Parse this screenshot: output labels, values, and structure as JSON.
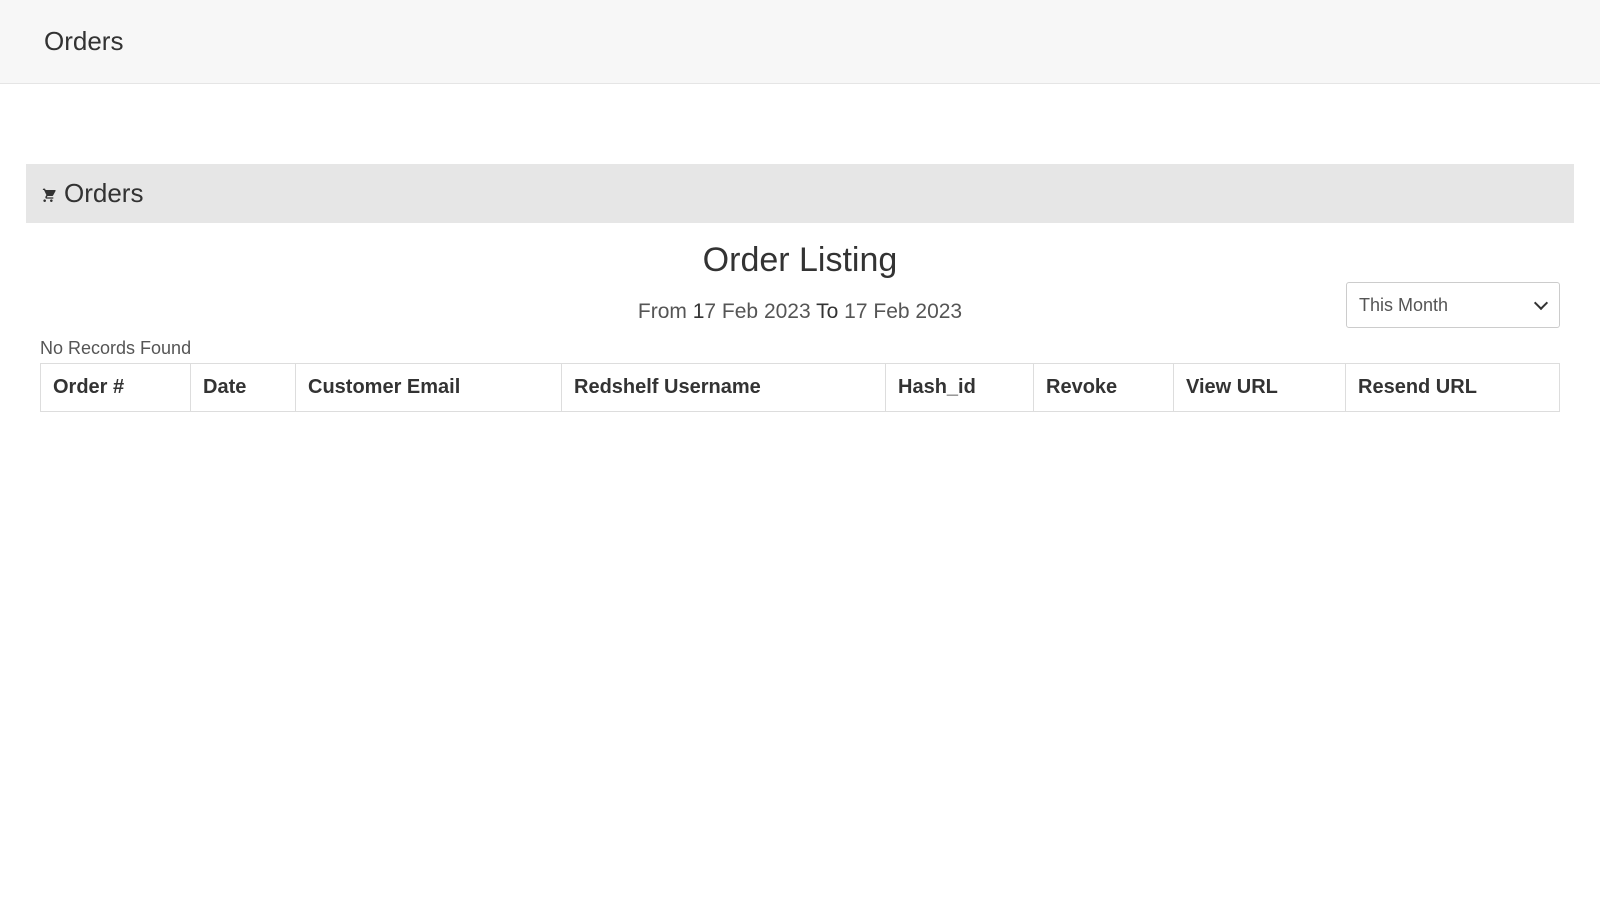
{
  "header": {
    "title": "Orders"
  },
  "panel": {
    "title": "Orders"
  },
  "listing": {
    "title": "Order Listing",
    "from_label": "From",
    "from_date_day": "1",
    "from_date_rest": "7 Feb 2023",
    "to_label": "To",
    "to_date": "17 Feb 2023",
    "no_records": "No Records Found"
  },
  "filter": {
    "selected": "This Month"
  },
  "table": {
    "columns": {
      "order_no": "Order #",
      "date": "Date",
      "customer_email": "Customer Email",
      "redshelf_username": "Redshelf Username",
      "hash_id": "Hash_id",
      "revoke": "Revoke",
      "view_url": "View URL",
      "resend_url": "Resend URL"
    }
  }
}
